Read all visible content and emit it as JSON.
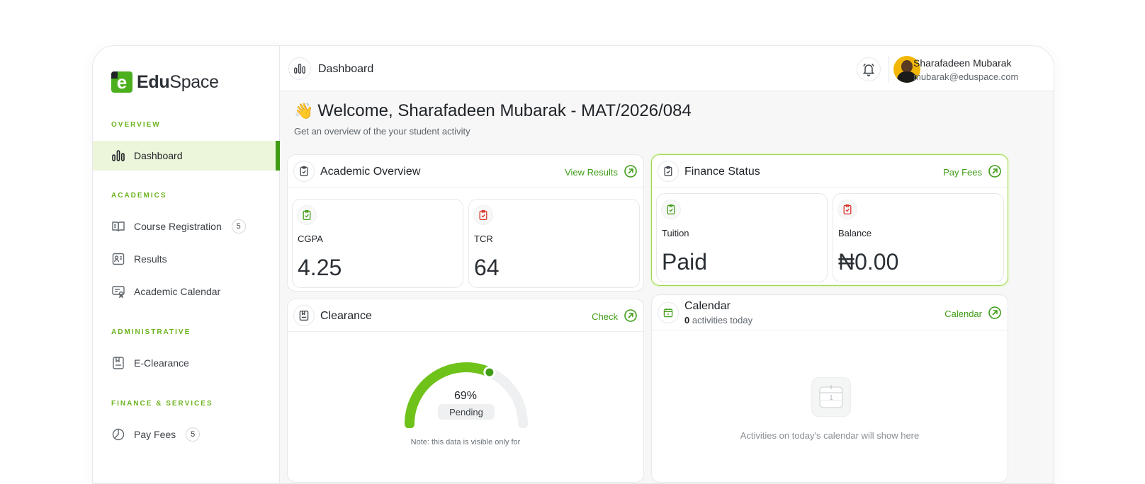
{
  "brand": {
    "name_bold": "Edu",
    "name_rest": "Space",
    "mark_letter": "e"
  },
  "sidebar": {
    "sections": [
      {
        "label": "OVERVIEW"
      },
      {
        "label": "ACADEMICS"
      },
      {
        "label": "ADMINISTRATIVE"
      },
      {
        "label": "FINANCE & SERVICES"
      }
    ],
    "items": [
      {
        "label": "Dashboard",
        "icon": "bar-chart-icon",
        "active": true
      },
      {
        "label": "Course Registration",
        "icon": "book-open-icon",
        "badge": "5"
      },
      {
        "label": "Results",
        "icon": "id-card-icon"
      },
      {
        "label": "Academic Calendar",
        "icon": "certificate-icon"
      },
      {
        "label": "E-Clearance",
        "icon": "bookmark-doc-icon"
      },
      {
        "label": "Pay Fees",
        "icon": "pie-chart-icon",
        "badge": "5"
      }
    ]
  },
  "topbar": {
    "title": "Dashboard",
    "user": {
      "name": "Sharafadeen Mubarak",
      "email": "mubarak@eduspace.com"
    }
  },
  "welcome": {
    "emoji": "👋",
    "title": "Welcome, Sharafadeen Mubarak - MAT/2026/084",
    "subtitle": "Get an overview of the your student activity"
  },
  "academic": {
    "title": "Academic Overview",
    "link": "View Results",
    "stats": [
      {
        "label": "CGPA",
        "value": "4.25",
        "icon_color": "#3f9c16"
      },
      {
        "label": "TCR",
        "value": "64",
        "icon_color": "#d93025"
      }
    ]
  },
  "finance": {
    "title": "Finance Status",
    "link": "Pay Fees",
    "stats": [
      {
        "label": "Tuition",
        "value": "Paid",
        "icon_color": "#3f9c16"
      },
      {
        "label": "Balance",
        "value": "₦0.00",
        "icon_color": "#d93025"
      }
    ]
  },
  "clearance": {
    "title": "Clearance",
    "link": "Check",
    "percent": 69,
    "percent_label": "69%",
    "status": "Pending",
    "note": "Note: this data is visible only for"
  },
  "calendar": {
    "title": "Calendar",
    "count": "0",
    "count_suffix": " activities today",
    "link": "Calendar",
    "empty_text": "Activities on today's calendar will show here",
    "empty_day": "1"
  },
  "colors": {
    "accent": "#3f9c16",
    "accent_light": "#8ccf1f",
    "active_bg": "#ecf6da",
    "danger": "#d93025"
  }
}
